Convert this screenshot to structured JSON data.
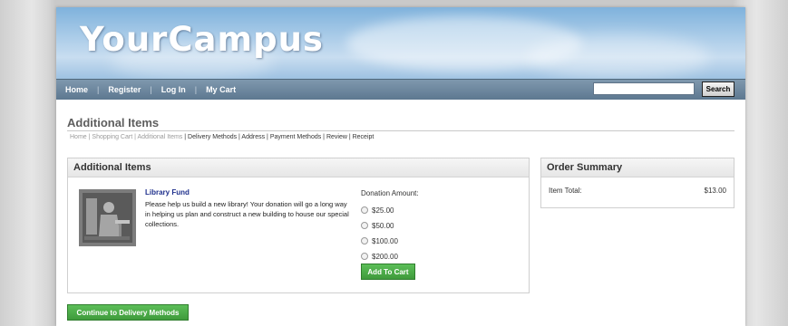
{
  "site": {
    "logo": "YourCampus"
  },
  "nav": {
    "items": [
      "Home",
      "Register",
      "Log In",
      "My Cart"
    ],
    "search_value": "",
    "search_button": "Search"
  },
  "page": {
    "title": "Additional Items",
    "breadcrumb": {
      "home": "Home",
      "cart": "Shopping Cart",
      "additional": "Additional Items",
      "rest": "Delivery Methods | Address | Payment Methods | Review | Receipt"
    }
  },
  "additional_items": {
    "heading": "Additional Items",
    "item": {
      "title": "Library Fund",
      "description": "Please help us build a new library! Your donation will go a long way in helping us plan and construct a new building to house our special collections.",
      "donation_label": "Donation Amount:",
      "options": [
        "$25.00",
        "$50.00",
        "$100.00",
        "$200.00"
      ],
      "add_to_cart": "Add To Cart"
    }
  },
  "order_summary": {
    "heading": "Order Summary",
    "item_total_label": "Item Total:",
    "item_total_value": "$13.00"
  },
  "continue_button": "Continue to Delivery Methods"
}
